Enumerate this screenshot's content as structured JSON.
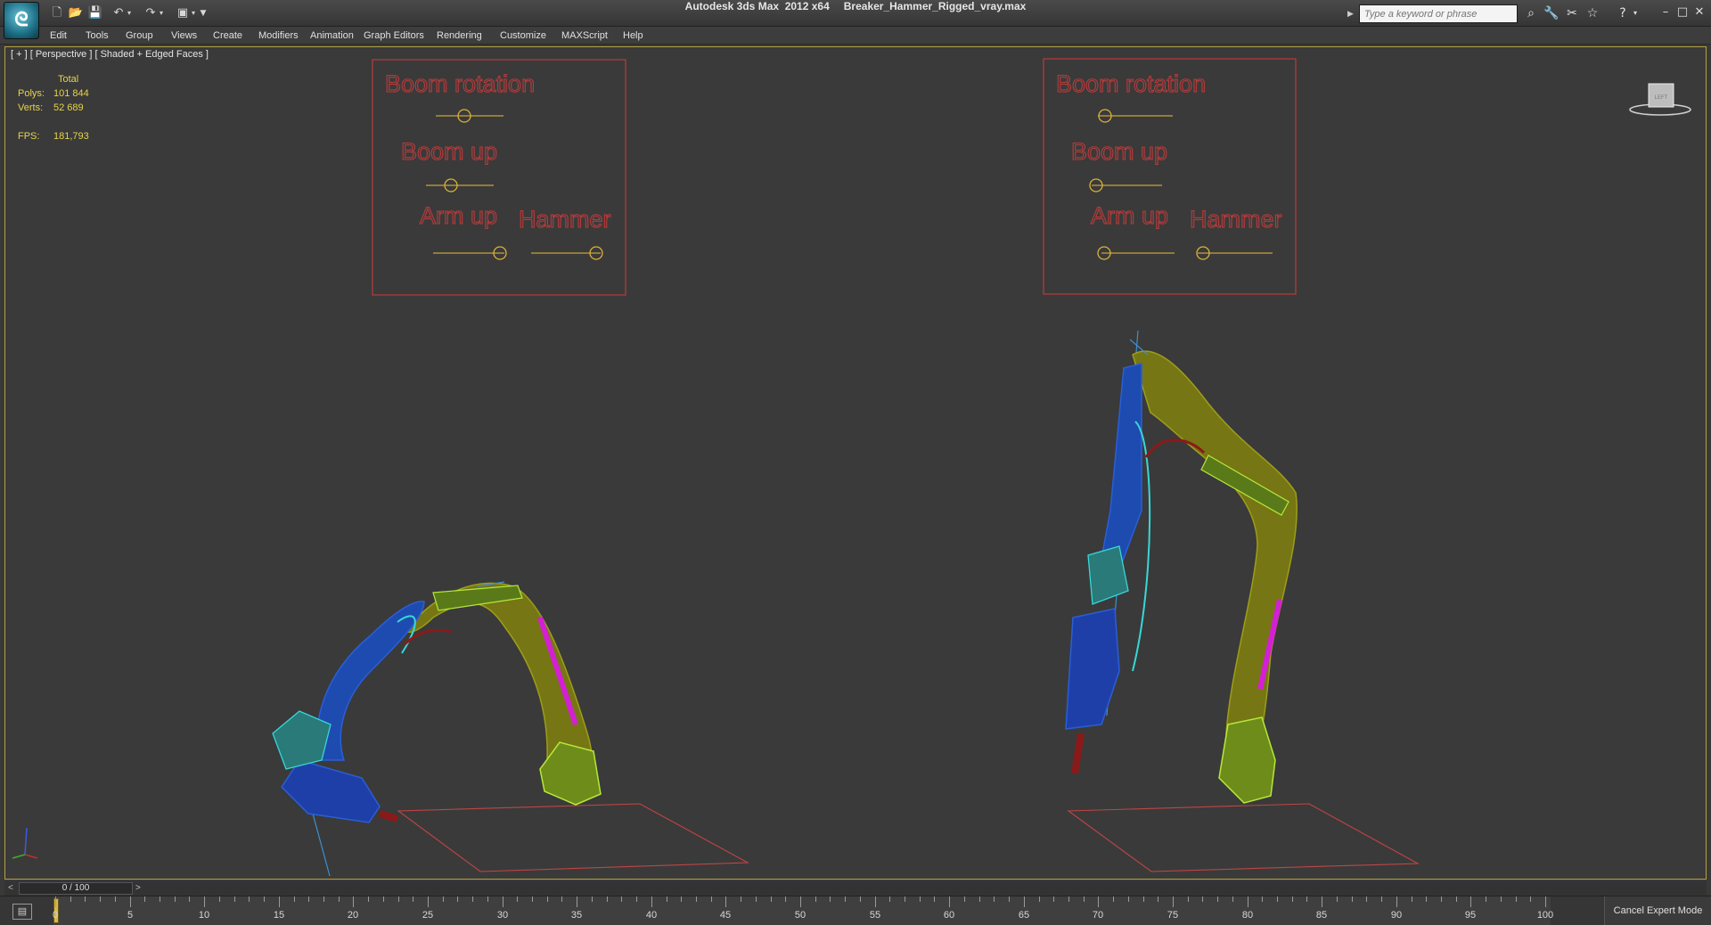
{
  "titlebar": {
    "app_name": "Autodesk 3ds Max  2012 x64",
    "file_name": "Breaker_Hammer_Rigged_vray.max",
    "search_placeholder": "Type a keyword or phrase",
    "logo_icon": "3dsmax-logo-icon"
  },
  "menu": [
    {
      "label": "Edit"
    },
    {
      "label": "Tools"
    },
    {
      "label": "Group"
    },
    {
      "label": "Views"
    },
    {
      "label": "Create"
    },
    {
      "label": "Modifiers"
    },
    {
      "label": "Animation"
    },
    {
      "label": "Graph Editors"
    },
    {
      "label": "Rendering"
    },
    {
      "label": "Customize"
    },
    {
      "label": "MAXScript"
    },
    {
      "label": "Help"
    }
  ],
  "viewport": {
    "label": "[ + ] [ Perspective ] [ Shaded + Edged Faces ]",
    "stats": {
      "total_header": "Total",
      "polys_label": "Polys:",
      "polys_value": "101 844",
      "verts_label": "Verts:",
      "verts_value": "52 689",
      "fps_label": "FPS:",
      "fps_value": "181,793"
    },
    "viewcube_label": "LEFT",
    "controls_left": {
      "boom_rotation": "Boom rotation",
      "boom_up": "Boom up",
      "arm_up": "Arm  up",
      "hammer": "Hammer"
    },
    "controls_right": {
      "boom_rotation": "Boom rotation",
      "boom_up": "Boom up",
      "arm_up": "Arm  up",
      "hammer": "Hammer"
    }
  },
  "timeline": {
    "frame_display": "0 / 100",
    "ticks": [
      "0",
      "5",
      "10",
      "15",
      "20",
      "25",
      "30",
      "35",
      "40",
      "45",
      "50",
      "55",
      "60",
      "65",
      "70",
      "75",
      "80",
      "85",
      "90",
      "95",
      "100"
    ],
    "current_frame": 0,
    "total_frames": 100,
    "expert_mode": "Cancel Expert Mode"
  },
  "colors": {
    "accent_yellow": "#e6d44a",
    "control_red": "#ba3a3a",
    "boom_olive": "#8c8c14",
    "wire_blue": "#2a5fd6",
    "wire_cyan": "#38d7d7",
    "wire_lime": "#b6e83a",
    "wire_magenta": "#d41fd4"
  }
}
